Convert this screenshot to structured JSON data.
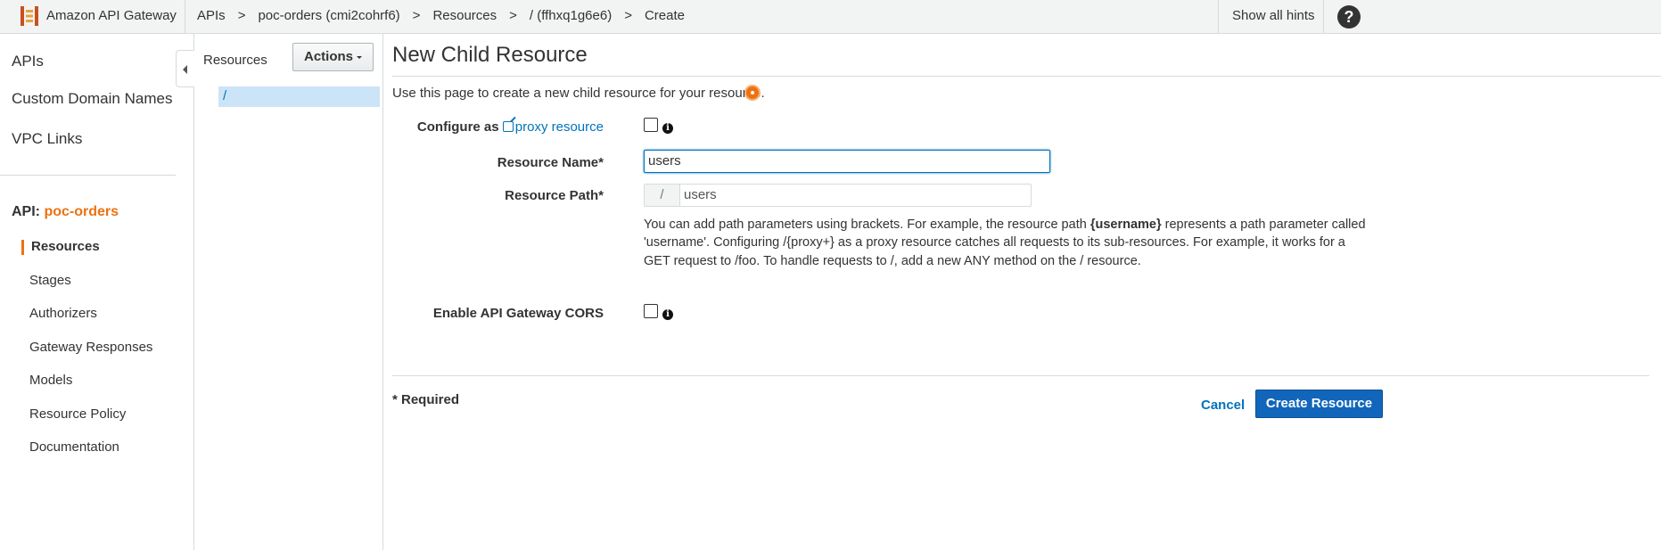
{
  "topbar": {
    "brand": "Amazon API Gateway",
    "breadcrumbs": [
      "APIs",
      "poc-orders (cmi2cohrf6)",
      "Resources",
      "/ (ffhxq1g6e6)",
      "Create"
    ],
    "separator": ">",
    "hints_label": "Show all hints",
    "help_glyph": "?"
  },
  "sidebar": {
    "top_items": [
      "APIs",
      "Custom Domain Names",
      "VPC Links"
    ],
    "api_prefix": "API:",
    "api_name": "poc-orders",
    "sub_items": [
      "Resources",
      "Stages",
      "Authorizers",
      "Gateway Responses",
      "Models",
      "Resource Policy",
      "Documentation"
    ],
    "active_item": "Resources"
  },
  "resources_panel": {
    "title": "Resources",
    "actions_label": "Actions",
    "tree_items": [
      "/"
    ]
  },
  "form": {
    "title": "New Child Resource",
    "intro": "Use this page to create a new child resource for your resource.",
    "proxy_label_prefix": "Configure as",
    "proxy_link": "proxy resource",
    "proxy_checked": false,
    "resource_name_label": "Resource Name*",
    "resource_name_value": "users",
    "resource_path_label": "Resource Path*",
    "resource_path_prefix": "/",
    "resource_path_value": "users",
    "help_part1": "You can add path parameters using brackets. For example, the resource path ",
    "help_bold": "{username}",
    "help_part2": " represents a path parameter called 'username'. Configuring /{proxy+} as a proxy resource catches all requests to its sub-resources. For example, it works for a GET request to /foo. To handle requests to /, add a new ANY method on the / resource.",
    "cors_label": "Enable API Gateway CORS",
    "cors_checked": false,
    "info_glyph": "i",
    "required_note": "* Required",
    "cancel_label": "Cancel",
    "submit_label": "Create Resource"
  },
  "colors": {
    "accent": "#ec7211",
    "link": "#0073bb",
    "primary_button": "#1166bb",
    "selection": "#cce4f7"
  }
}
